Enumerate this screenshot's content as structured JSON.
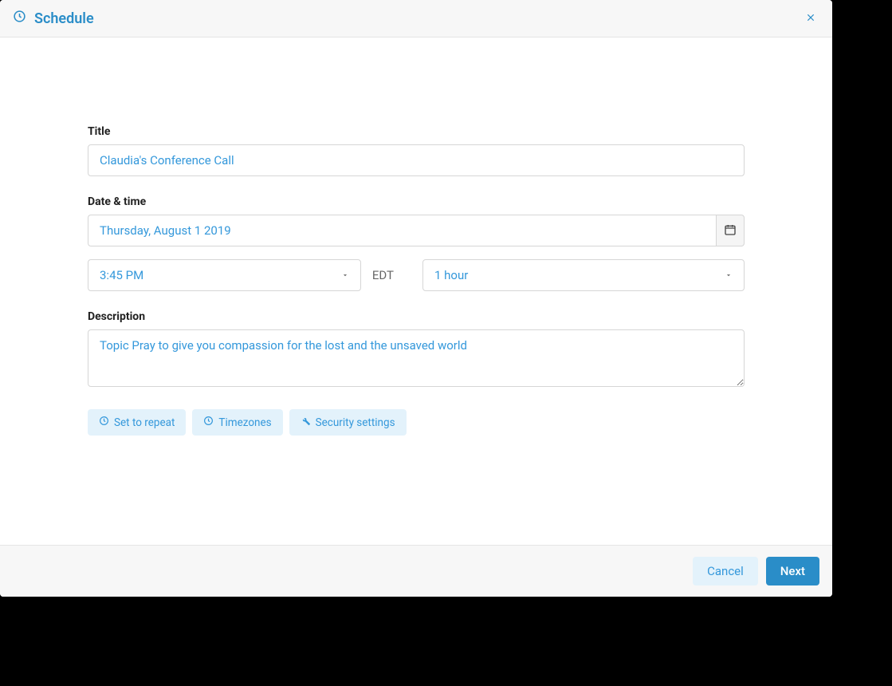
{
  "header": {
    "title": "Schedule"
  },
  "form": {
    "title_label": "Title",
    "title_value": "Claudia's Conference Call",
    "datetime_label": "Date & time",
    "date_value": "Thursday, August 1 2019",
    "time_value": "3:45 PM",
    "timezone": "EDT",
    "duration_value": "1 hour",
    "description_label": "Description",
    "description_value": "Topic Pray to give you compassion for the lost and the unsaved world"
  },
  "pills": {
    "repeat": "Set to repeat",
    "timezones": "Timezones",
    "security": "Security settings"
  },
  "footer": {
    "cancel": "Cancel",
    "next": "Next"
  }
}
